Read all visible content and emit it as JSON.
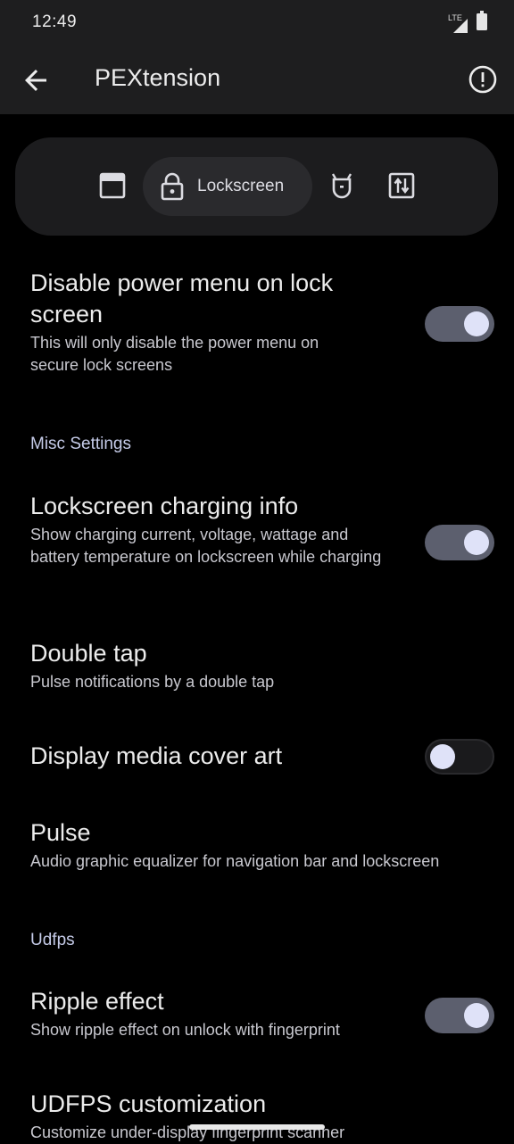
{
  "status": {
    "time": "12:49",
    "network": "LTE"
  },
  "appbar": {
    "title": "PEXtension"
  },
  "tabs": {
    "active_label": "Lockscreen"
  },
  "items": [
    {
      "title": "Disable power menu on lock screen",
      "subtitle": "This will only disable the power menu on secure lock screens",
      "toggle": "on"
    },
    {
      "title": "Lockscreen charging info",
      "subtitle": "Show charging current, voltage, wattage and battery temperature on lockscreen while charging",
      "toggle": "on"
    },
    {
      "title": "Double tap",
      "subtitle": "Pulse notifications by a double tap"
    },
    {
      "title": "Display media cover art",
      "toggle": "off"
    },
    {
      "title": "Pulse",
      "subtitle": "Audio graphic equalizer for navigation bar and lockscreen"
    },
    {
      "title": "Ripple effect",
      "subtitle": "Show ripple effect on unlock with fingerprint",
      "toggle": "on"
    },
    {
      "title": "UDFPS customization",
      "subtitle": "Customize under-display fingerprint scanner"
    }
  ],
  "sections": {
    "misc": "Misc Settings",
    "udfps": "Udfps"
  },
  "colors": {
    "accent": "#c5cbe8",
    "toggle_on_track": "#5c5f6e",
    "knob": "#dfe2f8"
  }
}
